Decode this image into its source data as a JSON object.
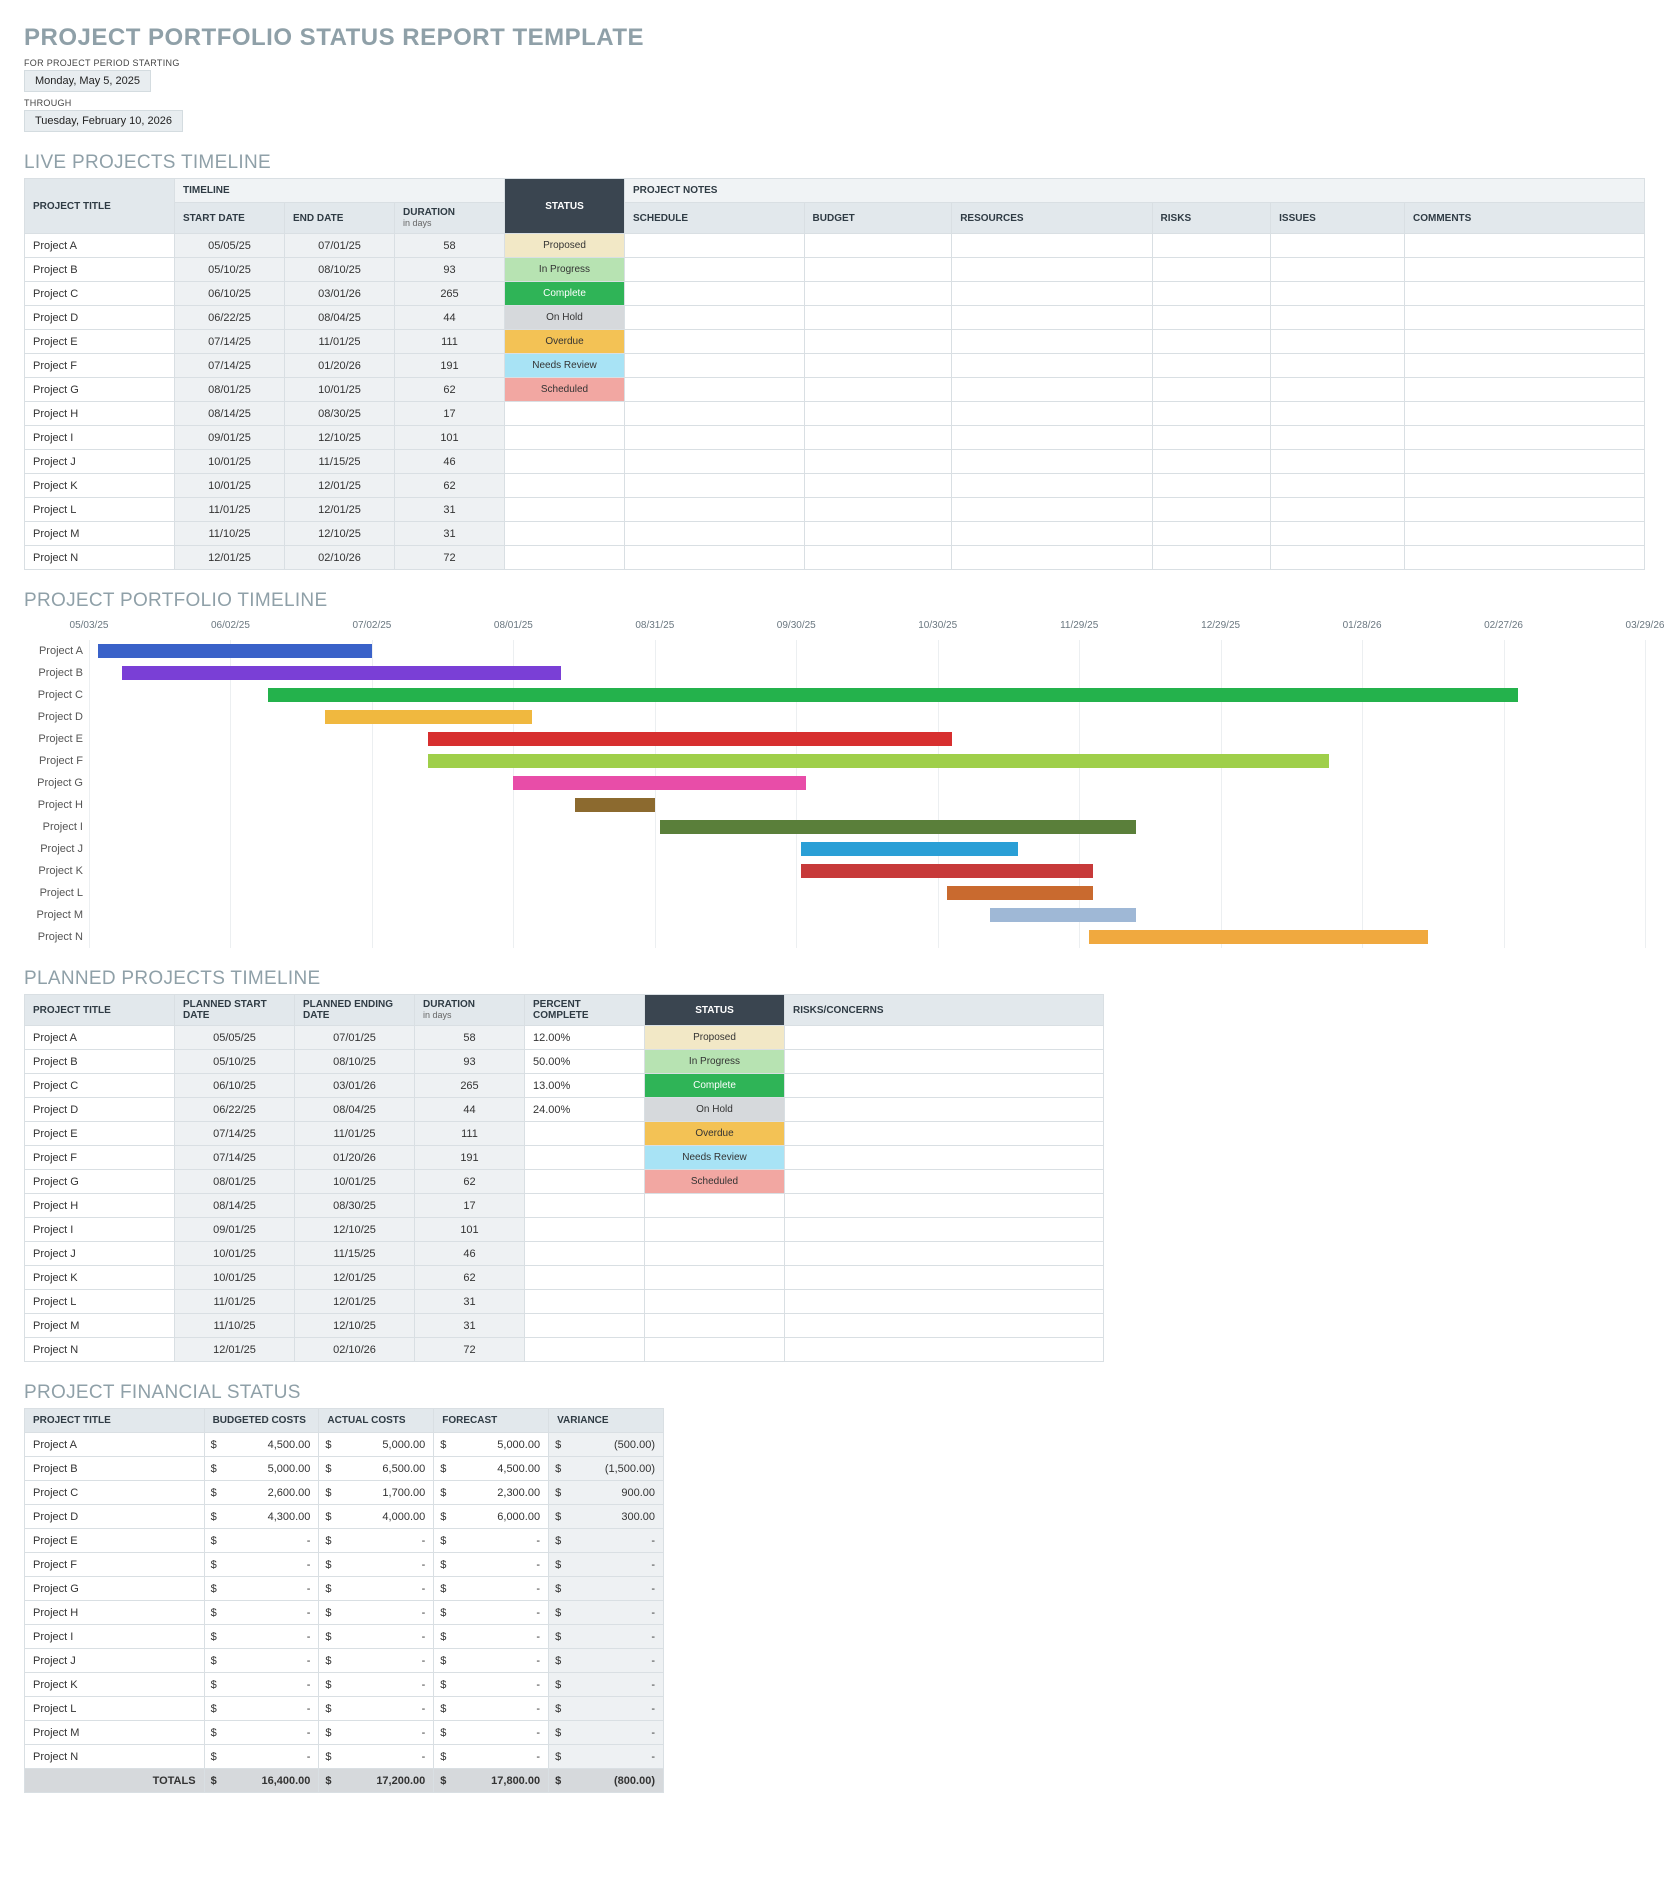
{
  "title": "PROJECT PORTFOLIO STATUS REPORT TEMPLATE",
  "period": {
    "start_label": "FOR PROJECT PERIOD STARTING",
    "start_value": "Monday, May 5, 2025",
    "through_label": "THROUGH",
    "end_value": "Tuesday, February 10, 2026"
  },
  "sections": {
    "live": "LIVE PROJECTS TIMELINE",
    "gantt": "PROJECT PORTFOLIO TIMELINE",
    "planned": "PLANNED PROJECTS TIMELINE",
    "financial": "PROJECT FINANCIAL STATUS"
  },
  "headers": {
    "timeline_group": "TIMELINE",
    "notes_group": "PROJECT NOTES",
    "project_title": "PROJECT TITLE",
    "start_date": "START DATE",
    "end_date": "END DATE",
    "duration": "DURATION",
    "duration_sub": "in days",
    "status": "STATUS",
    "schedule": "SCHEDULE",
    "budget": "BUDGET",
    "resources": "RESOURCES",
    "risks": "RISKS",
    "issues": "ISSUES",
    "comments": "COMMENTS",
    "planned_start": "PLANNED START DATE",
    "planned_end": "PLANNED ENDING DATE",
    "percent_complete": "PERCENT COMPLETE",
    "risks_concerns": "RISKS/CONCERNS",
    "budgeted_costs": "BUDGETED COSTS",
    "actual_costs": "ACTUAL COSTS",
    "forecast": "FORECAST",
    "variance": "VARIANCE",
    "totals": "TOTALS"
  },
  "live_rows": [
    {
      "title": "Project A",
      "start": "05/05/25",
      "end": "07/01/25",
      "duration": "58",
      "status": "Proposed"
    },
    {
      "title": "Project B",
      "start": "05/10/25",
      "end": "08/10/25",
      "duration": "93",
      "status": "In Progress"
    },
    {
      "title": "Project C",
      "start": "06/10/25",
      "end": "03/01/26",
      "duration": "265",
      "status": "Complete"
    },
    {
      "title": "Project D",
      "start": "06/22/25",
      "end": "08/04/25",
      "duration": "44",
      "status": "On Hold"
    },
    {
      "title": "Project E",
      "start": "07/14/25",
      "end": "11/01/25",
      "duration": "111",
      "status": "Overdue"
    },
    {
      "title": "Project F",
      "start": "07/14/25",
      "end": "01/20/26",
      "duration": "191",
      "status": "Needs Review"
    },
    {
      "title": "Project G",
      "start": "08/01/25",
      "end": "10/01/25",
      "duration": "62",
      "status": "Scheduled"
    },
    {
      "title": "Project H",
      "start": "08/14/25",
      "end": "08/30/25",
      "duration": "17",
      "status": ""
    },
    {
      "title": "Project I",
      "start": "09/01/25",
      "end": "12/10/25",
      "duration": "101",
      "status": ""
    },
    {
      "title": "Project J",
      "start": "10/01/25",
      "end": "11/15/25",
      "duration": "46",
      "status": ""
    },
    {
      "title": "Project K",
      "start": "10/01/25",
      "end": "12/01/25",
      "duration": "62",
      "status": ""
    },
    {
      "title": "Project L",
      "start": "11/01/25",
      "end": "12/01/25",
      "duration": "31",
      "status": ""
    },
    {
      "title": "Project M",
      "start": "11/10/25",
      "end": "12/10/25",
      "duration": "31",
      "status": ""
    },
    {
      "title": "Project N",
      "start": "12/01/25",
      "end": "02/10/26",
      "duration": "72",
      "status": ""
    }
  ],
  "chart_data": {
    "type": "bar",
    "orientation": "horizontal-gantt",
    "x_axis_ticks": [
      "05/03/25",
      "06/02/25",
      "07/02/25",
      "08/01/25",
      "08/31/25",
      "09/30/25",
      "10/30/25",
      "11/29/25",
      "12/29/25",
      "01/28/26",
      "02/27/26",
      "03/29/26"
    ],
    "x_range_days": 330,
    "x_start": "05/03/25",
    "series": [
      {
        "name": "Project A",
        "start_offset": 2,
        "duration": 58,
        "color": "#3a62c9"
      },
      {
        "name": "Project B",
        "start_offset": 7,
        "duration": 93,
        "color": "#7a3fd6"
      },
      {
        "name": "Project C",
        "start_offset": 38,
        "duration": 265,
        "color": "#24b24c"
      },
      {
        "name": "Project D",
        "start_offset": 50,
        "duration": 44,
        "color": "#f0b83f"
      },
      {
        "name": "Project E",
        "start_offset": 72,
        "duration": 111,
        "color": "#d72f2f"
      },
      {
        "name": "Project F",
        "start_offset": 72,
        "duration": 191,
        "color": "#9fcf4a"
      },
      {
        "name": "Project G",
        "start_offset": 90,
        "duration": 62,
        "color": "#e84da8"
      },
      {
        "name": "Project H",
        "start_offset": 103,
        "duration": 17,
        "color": "#8c6a2f"
      },
      {
        "name": "Project I",
        "start_offset": 121,
        "duration": 101,
        "color": "#5a7f3a"
      },
      {
        "name": "Project J",
        "start_offset": 151,
        "duration": 46,
        "color": "#2a9fd6"
      },
      {
        "name": "Project K",
        "start_offset": 151,
        "duration": 62,
        "color": "#c73a3a"
      },
      {
        "name": "Project L",
        "start_offset": 182,
        "duration": 31,
        "color": "#c96a2f"
      },
      {
        "name": "Project M",
        "start_offset": 191,
        "duration": 31,
        "color": "#9fb8d6"
      },
      {
        "name": "Project N",
        "start_offset": 212,
        "duration": 72,
        "color": "#f0a93f"
      }
    ]
  },
  "planned_rows": [
    {
      "title": "Project A",
      "start": "05/05/25",
      "end": "07/01/25",
      "duration": "58",
      "pct": "12.00%",
      "status": "Proposed"
    },
    {
      "title": "Project B",
      "start": "05/10/25",
      "end": "08/10/25",
      "duration": "93",
      "pct": "50.00%",
      "status": "In Progress"
    },
    {
      "title": "Project C",
      "start": "06/10/25",
      "end": "03/01/26",
      "duration": "265",
      "pct": "13.00%",
      "status": "Complete"
    },
    {
      "title": "Project D",
      "start": "06/22/25",
      "end": "08/04/25",
      "duration": "44",
      "pct": "24.00%",
      "status": "On Hold"
    },
    {
      "title": "Project E",
      "start": "07/14/25",
      "end": "11/01/25",
      "duration": "111",
      "pct": "",
      "status": "Overdue"
    },
    {
      "title": "Project F",
      "start": "07/14/25",
      "end": "01/20/26",
      "duration": "191",
      "pct": "",
      "status": "Needs Review"
    },
    {
      "title": "Project G",
      "start": "08/01/25",
      "end": "10/01/25",
      "duration": "62",
      "pct": "",
      "status": "Scheduled"
    },
    {
      "title": "Project H",
      "start": "08/14/25",
      "end": "08/30/25",
      "duration": "17",
      "pct": "",
      "status": ""
    },
    {
      "title": "Project I",
      "start": "09/01/25",
      "end": "12/10/25",
      "duration": "101",
      "pct": "",
      "status": ""
    },
    {
      "title": "Project J",
      "start": "10/01/25",
      "end": "11/15/25",
      "duration": "46",
      "pct": "",
      "status": ""
    },
    {
      "title": "Project K",
      "start": "10/01/25",
      "end": "12/01/25",
      "duration": "62",
      "pct": "",
      "status": ""
    },
    {
      "title": "Project L",
      "start": "11/01/25",
      "end": "12/01/25",
      "duration": "31",
      "pct": "",
      "status": ""
    },
    {
      "title": "Project M",
      "start": "11/10/25",
      "end": "12/10/25",
      "duration": "31",
      "pct": "",
      "status": ""
    },
    {
      "title": "Project N",
      "start": "12/01/25",
      "end": "02/10/26",
      "duration": "72",
      "pct": "",
      "status": ""
    }
  ],
  "financial_rows": [
    {
      "title": "Project A",
      "budgeted": "4,500.00",
      "actual": "5,000.00",
      "forecast": "5,000.00",
      "variance": "(500.00)"
    },
    {
      "title": "Project B",
      "budgeted": "5,000.00",
      "actual": "6,500.00",
      "forecast": "4,500.00",
      "variance": "(1,500.00)"
    },
    {
      "title": "Project C",
      "budgeted": "2,600.00",
      "actual": "1,700.00",
      "forecast": "2,300.00",
      "variance": "900.00"
    },
    {
      "title": "Project D",
      "budgeted": "4,300.00",
      "actual": "4,000.00",
      "forecast": "6,000.00",
      "variance": "300.00"
    },
    {
      "title": "Project E",
      "budgeted": "-",
      "actual": "-",
      "forecast": "-",
      "variance": "-"
    },
    {
      "title": "Project F",
      "budgeted": "-",
      "actual": "-",
      "forecast": "-",
      "variance": "-"
    },
    {
      "title": "Project G",
      "budgeted": "-",
      "actual": "-",
      "forecast": "-",
      "variance": "-"
    },
    {
      "title": "Project H",
      "budgeted": "-",
      "actual": "-",
      "forecast": "-",
      "variance": "-"
    },
    {
      "title": "Project I",
      "budgeted": "-",
      "actual": "-",
      "forecast": "-",
      "variance": "-"
    },
    {
      "title": "Project J",
      "budgeted": "-",
      "actual": "-",
      "forecast": "-",
      "variance": "-"
    },
    {
      "title": "Project K",
      "budgeted": "-",
      "actual": "-",
      "forecast": "-",
      "variance": "-"
    },
    {
      "title": "Project L",
      "budgeted": "-",
      "actual": "-",
      "forecast": "-",
      "variance": "-"
    },
    {
      "title": "Project M",
      "budgeted": "-",
      "actual": "-",
      "forecast": "-",
      "variance": "-"
    },
    {
      "title": "Project N",
      "budgeted": "-",
      "actual": "-",
      "forecast": "-",
      "variance": "-"
    }
  ],
  "financial_totals": {
    "budgeted": "16,400.00",
    "actual": "17,200.00",
    "forecast": "17,800.00",
    "variance": "(800.00)"
  }
}
